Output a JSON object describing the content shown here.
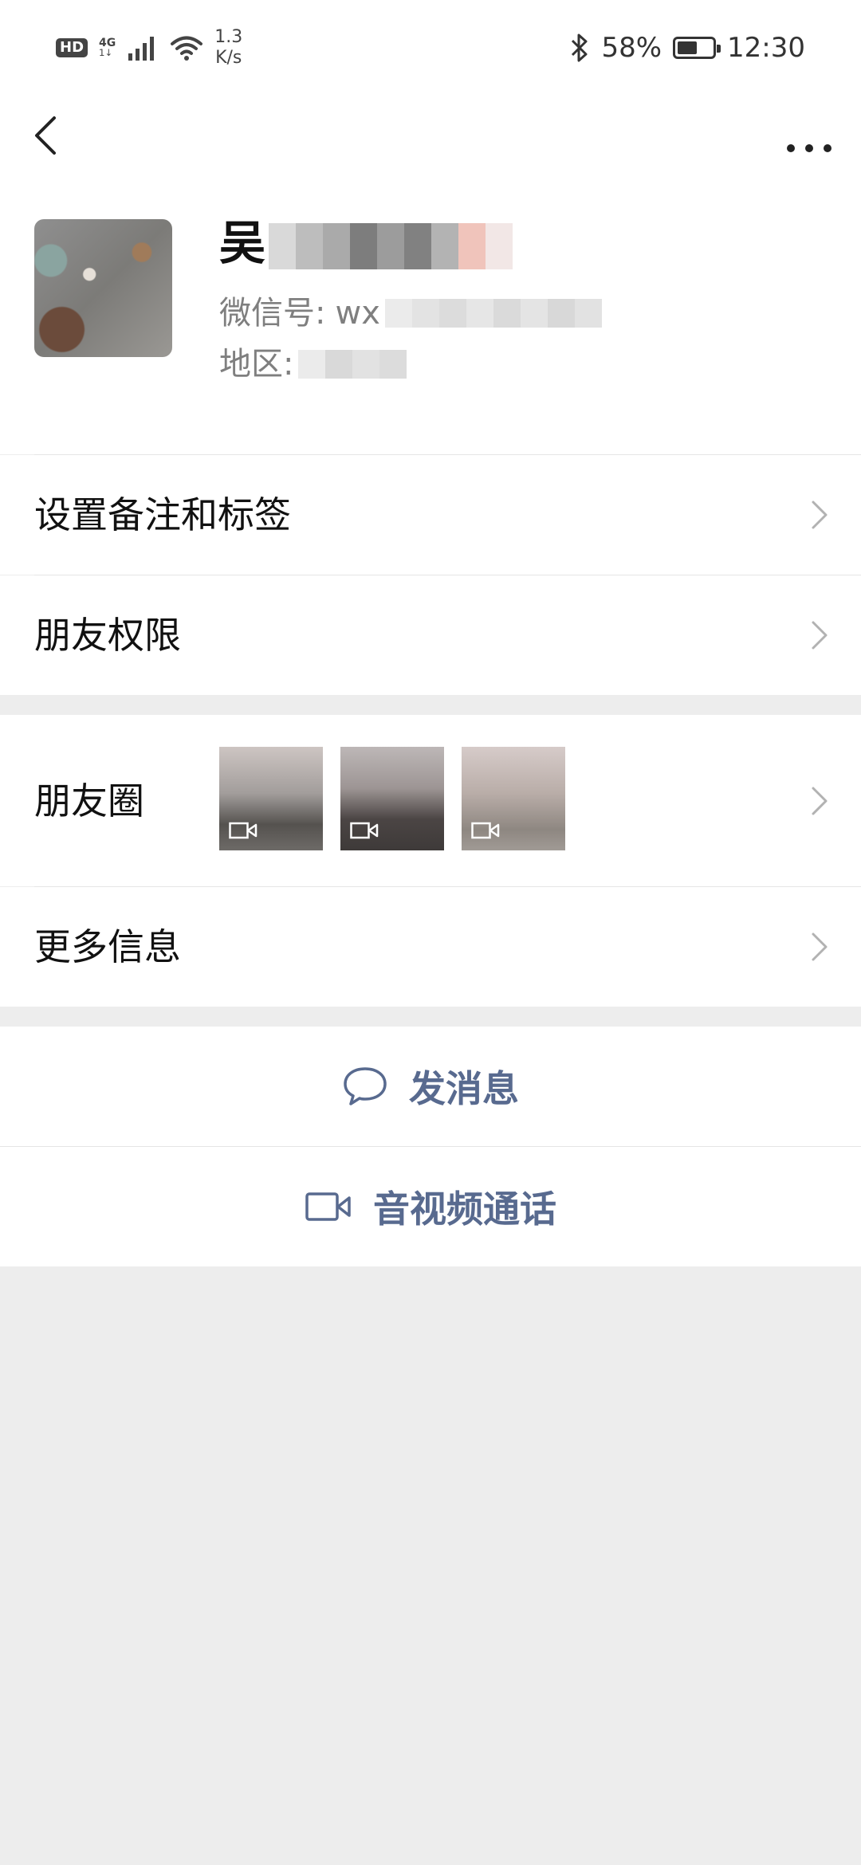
{
  "status_bar": {
    "hd": "HD",
    "net_type": "4G",
    "net_sub": "1↓",
    "speed_value": "1.3",
    "speed_unit": "K/s",
    "battery_percent": "58%",
    "battery_level": 0.58,
    "time": "12:30"
  },
  "profile": {
    "nickname_visible": "吴",
    "wechat_id_label": "微信号:",
    "wechat_id_value": "wx",
    "region_label": "地区:"
  },
  "menu": {
    "remark_tags": "设置备注和标签",
    "friend_permissions": "朋友权限",
    "moments": "朋友圈",
    "more_info": "更多信息"
  },
  "actions": {
    "send_message": "发消息",
    "av_call": "音视频通话"
  },
  "colors": {
    "accent_text": "#586a8f",
    "page_bg": "#ededed"
  }
}
